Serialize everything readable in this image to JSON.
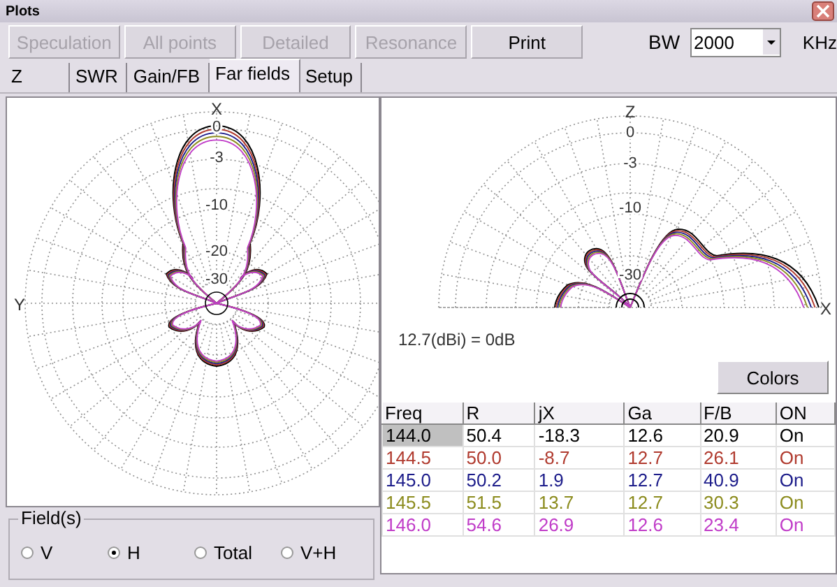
{
  "window": {
    "title": "Plots"
  },
  "toolbar": {
    "buttons": [
      {
        "label": "Speculation",
        "disabled": true
      },
      {
        "label": "All points",
        "disabled": true
      },
      {
        "label": "Detailed",
        "disabled": true
      },
      {
        "label": "Resonance",
        "disabled": true
      },
      {
        "label": "Print",
        "disabled": false
      }
    ],
    "bw": {
      "label": "BW",
      "value": "2000",
      "unit": "KHz"
    }
  },
  "tabs": [
    {
      "label": "Z",
      "selected": false
    },
    {
      "label": "SWR",
      "selected": false
    },
    {
      "label": "Gain/FB",
      "selected": false
    },
    {
      "label": "Far fields",
      "selected": true
    },
    {
      "label": "Setup",
      "selected": false
    }
  ],
  "azimuth_plot": {
    "axis_top": "X",
    "axis_side": "Y",
    "ring_labels": [
      "0",
      "-3",
      "-10",
      "-20",
      "-30"
    ]
  },
  "elevation_plot": {
    "axis_top": "Z",
    "axis_side": "X",
    "ring_labels": [
      "0",
      "-3",
      "-10",
      "-30"
    ]
  },
  "reference_note": "12.7(dBi) = 0dB",
  "colors_button": "Colors",
  "table": {
    "columns": [
      "Freq",
      "R",
      "jX",
      "Ga",
      "F/B",
      "ON"
    ],
    "rows": [
      {
        "color": "#000000",
        "selected": true,
        "cells": [
          "144.0",
          "50.4",
          "-18.3",
          "12.6",
          "20.9",
          "On"
        ]
      },
      {
        "color": "#b03a2e",
        "selected": false,
        "cells": [
          "144.5",
          "50.0",
          "-8.7",
          "12.7",
          "26.1",
          "On"
        ]
      },
      {
        "color": "#1c1c8a",
        "selected": false,
        "cells": [
          "145.0",
          "50.2",
          "1.9",
          "12.7",
          "40.9",
          "On"
        ]
      },
      {
        "color": "#8c8c1e",
        "selected": false,
        "cells": [
          "145.5",
          "51.5",
          "13.7",
          "12.7",
          "30.3",
          "On"
        ]
      },
      {
        "color": "#c03cc8",
        "selected": false,
        "cells": [
          "146.0",
          "54.6",
          "26.9",
          "12.6",
          "23.4",
          "On"
        ]
      }
    ]
  },
  "fields": {
    "title": "Field(s)",
    "options": [
      {
        "label": "V",
        "selected": false
      },
      {
        "label": "H",
        "selected": true
      },
      {
        "label": "Total",
        "selected": false
      },
      {
        "label": "V+H",
        "selected": false
      }
    ]
  }
}
